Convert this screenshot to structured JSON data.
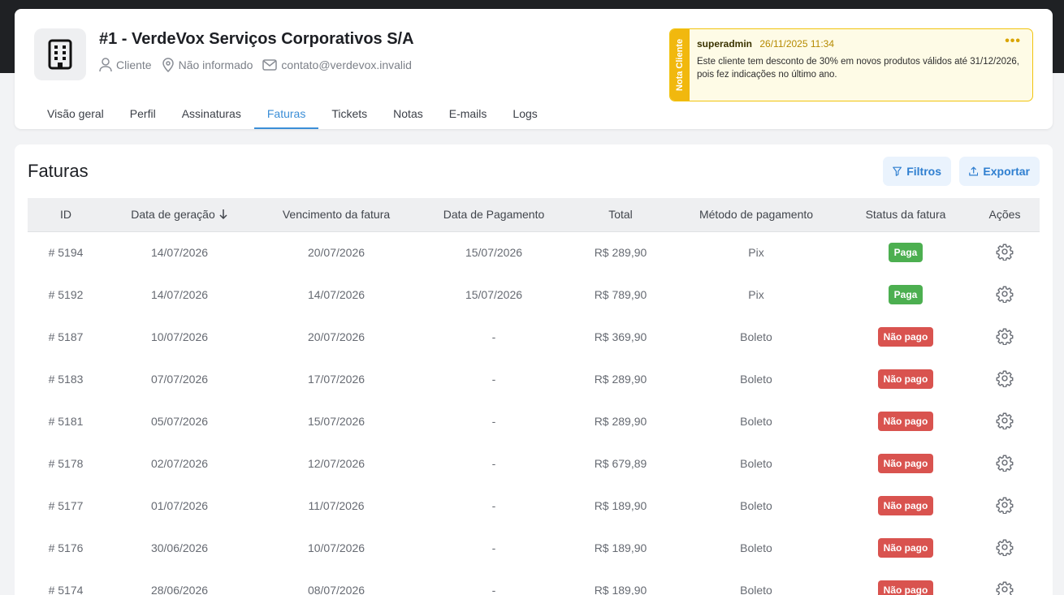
{
  "client": {
    "title": "#1 - VerdeVox Serviços Corporativos S/A",
    "type": "Cliente",
    "location": "Não informado",
    "email": "contato@verdevox.invalid"
  },
  "tabs": [
    {
      "label": "Visão geral",
      "active": false
    },
    {
      "label": "Perfil",
      "active": false
    },
    {
      "label": "Assinaturas",
      "active": false
    },
    {
      "label": "Faturas",
      "active": true
    },
    {
      "label": "Tickets",
      "active": false
    },
    {
      "label": "Notas",
      "active": false
    },
    {
      "label": "E-mails",
      "active": false
    },
    {
      "label": "Logs",
      "active": false
    }
  ],
  "note": {
    "side_label": "Nota Cliente",
    "user": "superadmin",
    "date": "26/11/2025 11:34",
    "menu": "•••",
    "text": "Este cliente tem desconto de 30% em novos produtos válidos até 31/12/2026, pois fez indicações no último ano."
  },
  "page": {
    "title": "Faturas",
    "filters_label": "Filtros",
    "export_label": "Exportar"
  },
  "table": {
    "headers": {
      "id": "ID",
      "generated": "Data de geração",
      "due": "Vencimento da fatura",
      "paid_date": "Data de Pagamento",
      "total": "Total",
      "method": "Método de pagamento",
      "status": "Status da fatura",
      "actions": "Ações"
    },
    "rows": [
      {
        "id": "# 5194",
        "generated": "14/07/2026",
        "due": "20/07/2026",
        "paid_date": "15/07/2026",
        "total": "R$ 289,90",
        "method": "Pix",
        "status": "Paga",
        "status_kind": "paid"
      },
      {
        "id": "# 5192",
        "generated": "14/07/2026",
        "due": "14/07/2026",
        "paid_date": "15/07/2026",
        "total": "R$ 789,90",
        "method": "Pix",
        "status": "Paga",
        "status_kind": "paid"
      },
      {
        "id": "# 5187",
        "generated": "10/07/2026",
        "due": "20/07/2026",
        "paid_date": "-",
        "total": "R$ 369,90",
        "method": "Boleto",
        "status": "Não pago",
        "status_kind": "unpaid"
      },
      {
        "id": "# 5183",
        "generated": "07/07/2026",
        "due": "17/07/2026",
        "paid_date": "-",
        "total": "R$ 289,90",
        "method": "Boleto",
        "status": "Não pago",
        "status_kind": "unpaid"
      },
      {
        "id": "# 5181",
        "generated": "05/07/2026",
        "due": "15/07/2026",
        "paid_date": "-",
        "total": "R$ 289,90",
        "method": "Boleto",
        "status": "Não pago",
        "status_kind": "unpaid"
      },
      {
        "id": "# 5178",
        "generated": "02/07/2026",
        "due": "12/07/2026",
        "paid_date": "-",
        "total": "R$ 679,89",
        "method": "Boleto",
        "status": "Não pago",
        "status_kind": "unpaid"
      },
      {
        "id": "# 5177",
        "generated": "01/07/2026",
        "due": "11/07/2026",
        "paid_date": "-",
        "total": "R$ 189,90",
        "method": "Boleto",
        "status": "Não pago",
        "status_kind": "unpaid"
      },
      {
        "id": "# 5176",
        "generated": "30/06/2026",
        "due": "10/07/2026",
        "paid_date": "-",
        "total": "R$ 189,90",
        "method": "Boleto",
        "status": "Não pago",
        "status_kind": "unpaid"
      },
      {
        "id": "# 5174",
        "generated": "28/06/2026",
        "due": "08/07/2026",
        "paid_date": "-",
        "total": "R$ 189,90",
        "method": "Boleto",
        "status": "Não pago",
        "status_kind": "unpaid"
      }
    ]
  },
  "colors": {
    "accent": "#3b8ed7",
    "paid": "#4caf50",
    "unpaid": "#d9534f",
    "note_bg": "#fefbe6",
    "note_border": "#f1c40f"
  }
}
